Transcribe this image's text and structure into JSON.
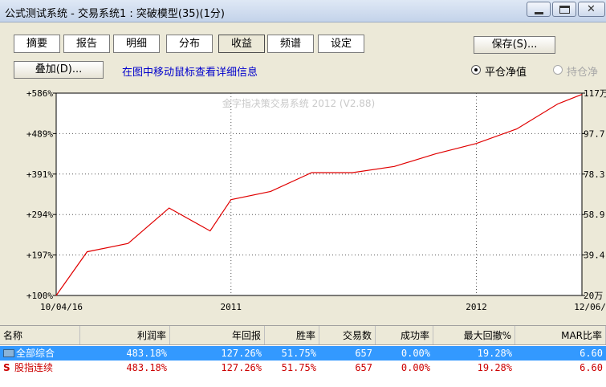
{
  "window": {
    "title": "公式测试系统 - 交易系统1 : 突破模型(35)(1分)"
  },
  "tabs": [
    {
      "label": "摘要",
      "active": false
    },
    {
      "label": "报告",
      "active": false
    },
    {
      "label": "明细",
      "active": false
    },
    {
      "label": "分布",
      "active": false
    },
    {
      "label": "收益",
      "active": true
    },
    {
      "label": "频谱",
      "active": false
    },
    {
      "label": "设定",
      "active": false
    }
  ],
  "toolbar": {
    "save_label": "保存(S)...",
    "overlay_label": "叠加(D)...",
    "hint": "在图中移动鼠标查看详细信息",
    "radio_close": "平仓净值",
    "radio_hold": "持仓净"
  },
  "chart_data": {
    "type": "line",
    "watermark": "金字指决策交易系统 2012 (V2.88)",
    "y_left_ticks": [
      "+586%",
      "+489%",
      "+391%",
      "+294%",
      "+197%",
      "+100%"
    ],
    "y_right_ticks": [
      "117万",
      "97.7",
      "78.3",
      "58.9",
      "39.4",
      "20万"
    ],
    "y_right_range": [
      20,
      117
    ],
    "x_tick_labels": [
      "10/04/16",
      "2011",
      "2012",
      "12/06/"
    ],
    "x_dates": [
      "2010-04-16",
      "2010-06-01",
      "2010-08-01",
      "2010-10-01",
      "2010-12-01",
      "2011-01-01",
      "2011-03-01",
      "2011-05-01",
      "2011-07-01",
      "2011-09-01",
      "2011-11-01",
      "2012-01-01",
      "2012-03-01",
      "2012-05-01",
      "2012-06-06"
    ],
    "series": [
      {
        "color": "#e00000",
        "values": [
          100,
          205,
          225,
          310,
          255,
          330,
          350,
          395,
          395,
          410,
          440,
          465,
          500,
          560,
          583
        ]
      }
    ],
    "line_color": "#e00000",
    "grid": true
  },
  "table": {
    "columns": [
      "名称",
      "利润率",
      "年回报",
      "胜率",
      "交易数",
      "成功率",
      "最大回撤%",
      "MAR比率"
    ],
    "rows": [
      {
        "name": "全部综合",
        "icon": "folder-icon",
        "profit": "483.18%",
        "annual": "127.26%",
        "win": "51.75%",
        "trades": "657",
        "success": "0.00%",
        "drawdown": "19.28%",
        "mar": "6.60"
      },
      {
        "name": "股指连续",
        "icon": "S",
        "profit": "483.18%",
        "annual": "127.26%",
        "win": "51.75%",
        "trades": "657",
        "success": "0.00%",
        "drawdown": "19.28%",
        "mar": "6.60"
      }
    ]
  }
}
